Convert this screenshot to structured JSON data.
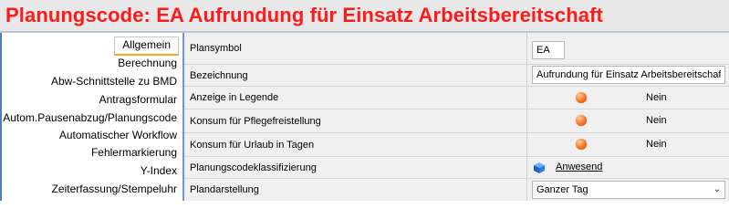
{
  "window": {
    "title": "Planungscode: EA Aufrundung für Einsatz Arbeitsbereitschaft"
  },
  "sidebar": {
    "items": [
      {
        "label": "Allgemein",
        "active": true
      },
      {
        "label": "Berechnung"
      },
      {
        "label": "Abw-Schnittstelle zu BMD"
      },
      {
        "label": "Antragsformular"
      },
      {
        "label": "Autom.Pausenabzug/Planungscode"
      },
      {
        "label": "Automatischer Workflow"
      },
      {
        "label": "Fehlermarkierung"
      },
      {
        "label": "Y-Index"
      },
      {
        "label": "Zeiterfassung/Stempeluhr"
      }
    ]
  },
  "rows": {
    "plansymbol": {
      "label": "Plansymbol",
      "value": "EA"
    },
    "bezeichnung": {
      "label": "Bezeichnung",
      "value": "Aufrundung für Einsatz Arbeitsbereitschaft"
    },
    "anzeige": {
      "label": "Anzeige in Legende",
      "value": "Nein"
    },
    "pflege": {
      "label": "Konsum für Pflegefreistellung",
      "value": "Nein"
    },
    "urlaub": {
      "label": "Konsum für Urlaub in Tagen",
      "value": "Nein"
    },
    "klassifizierung": {
      "label": "Planungscodeklassifizierung",
      "value": "Anwesend",
      "icon": "cube-icon"
    },
    "plandarstellung": {
      "label": "Plandarstellung",
      "value": "Ganzer Tag"
    }
  },
  "colors": {
    "title": "#ff1a1a",
    "accent": "#f5a623",
    "status_dot": "#ff6a1a"
  }
}
